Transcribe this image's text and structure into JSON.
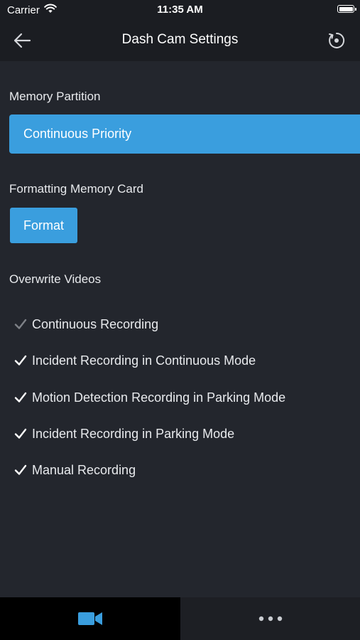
{
  "status_bar": {
    "carrier": "Carrier",
    "time": "11:35 AM",
    "wifi_icon": "wifi-icon",
    "battery_icon": "battery-icon"
  },
  "nav": {
    "title": "Dash Cam Settings",
    "back_icon": "arrow-left-icon",
    "reset_icon": "reset-icon"
  },
  "memory_partition": {
    "label": "Memory Partition",
    "selected": "Continuous Priority"
  },
  "formatting": {
    "label": "Formatting Memory Card",
    "button_label": "Format"
  },
  "overwrite": {
    "label": "Overwrite Videos",
    "options": [
      {
        "label": "Continuous Recording",
        "checked": true,
        "enabled": false
      },
      {
        "label": "Incident Recording in Continuous Mode",
        "checked": true,
        "enabled": true
      },
      {
        "label": "Motion Detection Recording in Parking Mode",
        "checked": true,
        "enabled": true
      },
      {
        "label": "Incident Recording in Parking Mode",
        "checked": true,
        "enabled": true
      },
      {
        "label": "Manual Recording",
        "checked": true,
        "enabled": true
      }
    ]
  },
  "tab_bar": {
    "tabs": [
      {
        "icon": "video-camera-icon",
        "active": true
      },
      {
        "icon": "more-dots-icon",
        "active": false
      }
    ]
  },
  "colors": {
    "accent": "#3a9ede",
    "background": "#23262d",
    "header": "#1b1d22",
    "text": "#e8eaed"
  }
}
